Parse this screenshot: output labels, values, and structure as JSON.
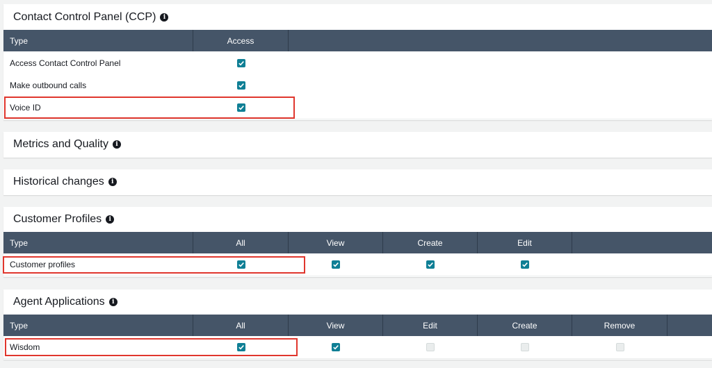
{
  "ccp": {
    "title": "Contact Control Panel (CCP)",
    "headers": [
      "Type",
      "Access"
    ],
    "rows": [
      {
        "type": "Access Contact Control Panel",
        "access": "checked"
      },
      {
        "type": "Make outbound calls",
        "access": "checked"
      },
      {
        "type": "Voice ID",
        "access": "checked"
      }
    ]
  },
  "metrics": {
    "title": "Metrics and Quality"
  },
  "historical": {
    "title": "Historical changes"
  },
  "customer_profiles": {
    "title": "Customer Profiles",
    "headers": [
      "Type",
      "All",
      "View",
      "Create",
      "Edit"
    ],
    "rows": [
      {
        "type": "Customer profiles",
        "all": "checked",
        "view": "checked",
        "create": "checked",
        "edit": "checked"
      }
    ]
  },
  "agent_apps": {
    "title": "Agent Applications",
    "headers": [
      "Type",
      "All",
      "View",
      "Edit",
      "Create",
      "Remove"
    ],
    "rows": [
      {
        "type": "Wisdom",
        "all": "checked",
        "view": "checked",
        "edit": "unchecked",
        "create": "unchecked",
        "remove": "unchecked"
      }
    ]
  },
  "colors": {
    "header_bg": "#455568",
    "checkbox_checked": "#0f7f95",
    "highlight": "#e0362d"
  }
}
